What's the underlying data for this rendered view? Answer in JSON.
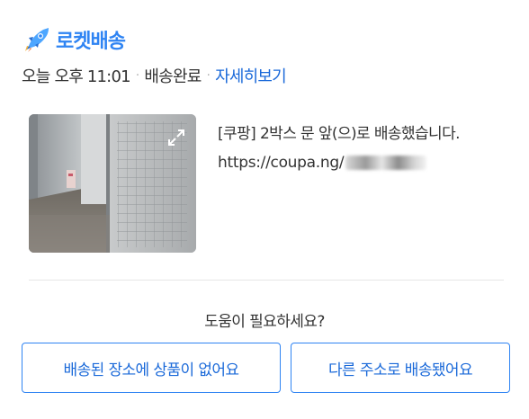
{
  "header": {
    "brand_icon": "rocket-icon",
    "brand_label": "로켓배송",
    "brand_color": "#2f84f3"
  },
  "status": {
    "date": "오늘 오후 11:01",
    "state": "배송완료",
    "details_link": "자세히보기",
    "link_color": "#1a69d9"
  },
  "delivery": {
    "photo_icon": "expand-icon",
    "message": "[쿠팡] 2박스 문 앞(으)로 배송했습니다.",
    "url": "https://coupa.ng/"
  },
  "help": {
    "prompt": "도움이 필요하세요?",
    "not_found_button": "배송된 장소에 상품이 없어요",
    "wrong_address_button": "다른 주소로 배송됐어요"
  }
}
